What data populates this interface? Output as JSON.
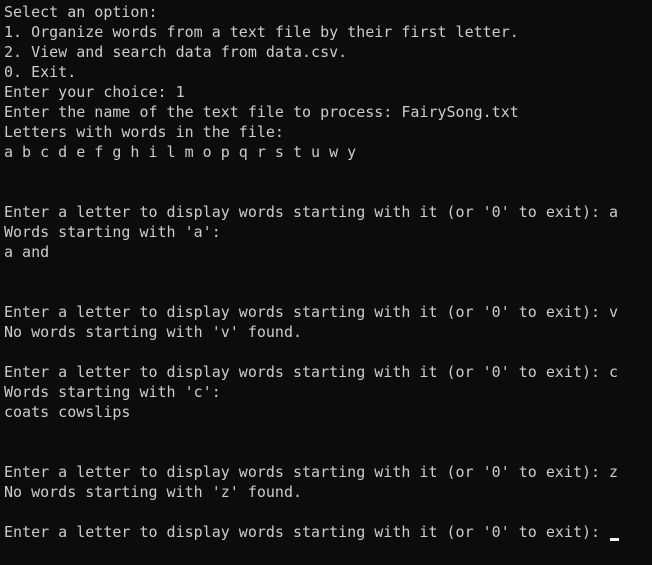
{
  "console": {
    "lines": [
      "Select an option:",
      "1. Organize words from a text file by their first letter.",
      "2. View and search data from data.csv.",
      "0. Exit.",
      "Enter your choice: 1",
      "Enter the name of the text file to process: FairySong.txt",
      "Letters with words in the file:",
      "a b c d e f g h i l m o p q r s t u w y",
      "",
      "",
      "Enter a letter to display words starting with it (or '0' to exit): a",
      "Words starting with 'a':",
      "a and",
      "",
      "",
      "Enter a letter to display words starting with it (or '0' to exit): v",
      "No words starting with 'v' found.",
      "",
      "Enter a letter to display words starting with it (or '0' to exit): c",
      "Words starting with 'c':",
      "coats cowslips",
      "",
      "",
      "Enter a letter to display words starting with it (or '0' to exit): z",
      "No words starting with 'z' found.",
      "",
      "Enter a letter to display words starting with it (or '0' to exit): "
    ]
  }
}
